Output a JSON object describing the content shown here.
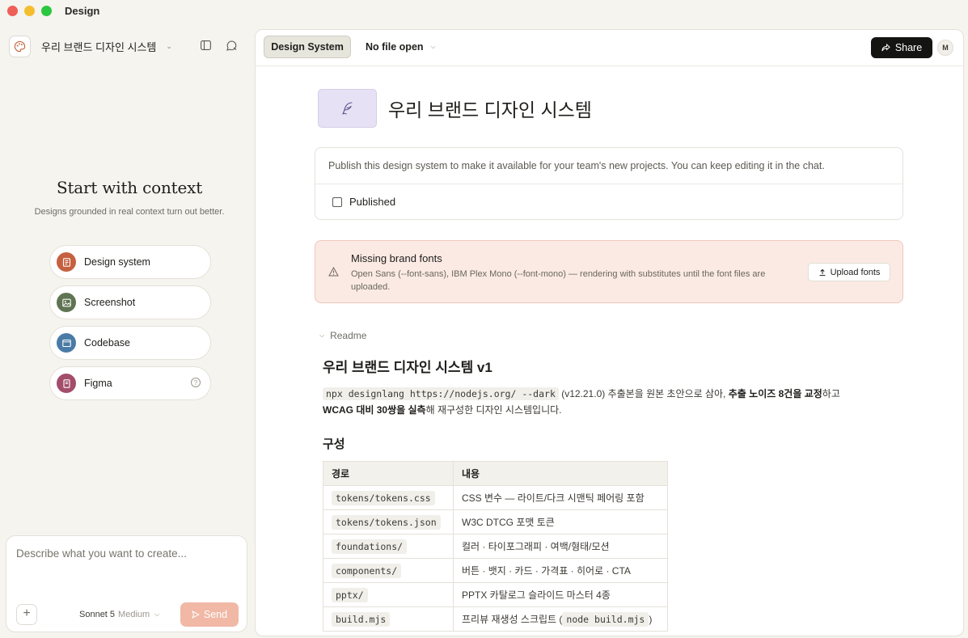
{
  "window": {
    "title": "Design"
  },
  "sidebar": {
    "project_name": "우리 브랜드 디자인 시스템",
    "context": {
      "title": "Start with context",
      "subtitle": "Designs grounded in real context turn out better."
    },
    "items": [
      {
        "label": "Design system",
        "icon": "design-system-icon",
        "color": "#c5613f"
      },
      {
        "label": "Screenshot",
        "icon": "screenshot-icon",
        "color": "#5f7452"
      },
      {
        "label": "Codebase",
        "icon": "codebase-icon",
        "color": "#4a7ba6"
      },
      {
        "label": "Figma",
        "icon": "figma-icon",
        "color": "#a34d6b"
      }
    ],
    "composer": {
      "placeholder": "Describe what you want to create...",
      "model": "Sonnet 5",
      "effort": "Medium",
      "send_label": "Send"
    }
  },
  "topbar": {
    "tab_label": "Design System",
    "file_label": "No file open",
    "share_label": "Share",
    "user_initial": "M"
  },
  "design_system": {
    "title": "우리 브랜드 디자인 시스템",
    "publish_description": "Publish this design system to make it available for your team's new projects. You can keep editing it in the chat.",
    "published_label": "Published",
    "published": false
  },
  "warning": {
    "title": "Missing brand fonts",
    "body": "Open Sans (--font-sans), IBM Plex Mono (--font-mono) — rendering with substitutes until the font files are uploaded.",
    "button_label": "Upload fonts"
  },
  "readme": {
    "toggle_label": "Readme",
    "heading": "우리 브랜드 디자인 시스템 v1",
    "intro": {
      "code": "npx designlang https://nodejs.org/ --dark",
      "part1": " (v12.21.0) 추출본을 원본 초안으로 삼아, ",
      "bold1": "추출 노이즈 8건을 교정",
      "part2": "하고",
      "bold2": "WCAG 대비 30쌍을 실측",
      "part3": "해 재구성한 디자인 시스템입니다."
    },
    "section_heading": "구성",
    "table": {
      "headers": [
        "경로",
        "내용"
      ],
      "rows": [
        {
          "path": "tokens/tokens.css",
          "desc": "CSS 변수 — 라이트/다크 시맨틱 페어링 포함"
        },
        {
          "path": "tokens/tokens.json",
          "desc": "W3C DTCG 포맷 토큰"
        },
        {
          "path": "foundations/",
          "desc": "컬러 · 타이포그래피 · 여백/형태/모션"
        },
        {
          "path": "components/",
          "desc": "버튼 · 뱃지 · 카드 · 가격표 · 히어로 · CTA"
        },
        {
          "path": "pptx/",
          "desc": "PPTX 카탈로그 슬라이드 마스터 4종"
        },
        {
          "path": "build.mjs",
          "desc_prefix": "프리뷰 재생성 스크립트 (",
          "desc_code": "node build.mjs",
          "desc_suffix": ")"
        }
      ]
    }
  },
  "colors": {
    "accent": "#d97757",
    "send_disabled": "#f1b8a6",
    "warning_bg": "#fbeae4",
    "share_bg": "#141413"
  }
}
